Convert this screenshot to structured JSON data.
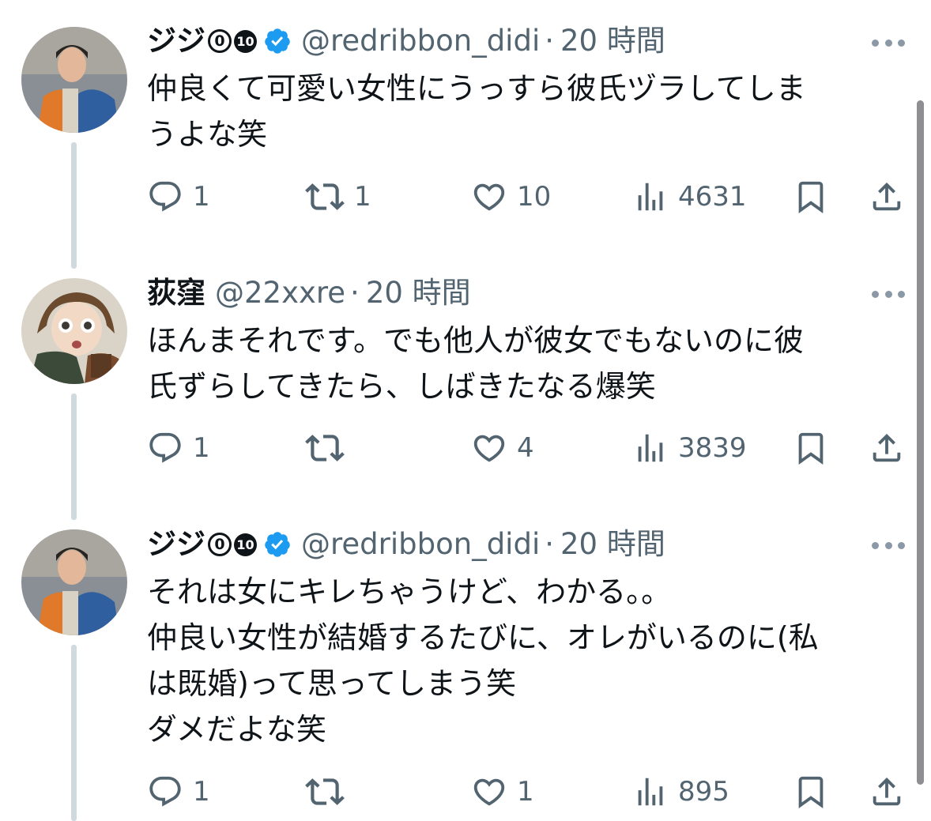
{
  "tweets": [
    {
      "name": "ジジ",
      "badge1": "0",
      "badge2": "10",
      "verified": true,
      "handle": "@redribbon_didi",
      "dot": "·",
      "time": "20 時間",
      "lines": [
        "仲良くて可愛い女性にうっすら彼氏ヅラしてしま",
        "うよな笑"
      ],
      "replies": "1",
      "retweets": "1",
      "likes": "10",
      "views": "4631"
    },
    {
      "name": "荻窪",
      "handle": "@22xxre",
      "dot": "·",
      "time": "20 時間",
      "lines": [
        "ほんまそれです。でも他人が彼女でもないのに彼",
        "氏ずらしてきたら、しばきたなる爆笑"
      ],
      "replies": "1",
      "retweets": "",
      "likes": "4",
      "views": "3839"
    },
    {
      "name": "ジジ",
      "badge1": "0",
      "badge2": "10",
      "verified": true,
      "handle": "@redribbon_didi",
      "dot": "·",
      "time": "20 時間",
      "lines": [
        "それは女にキレちゃうけど、わかる。。",
        "仲良い女性が結婚するたびに、オレがいるのに(私",
        "は既婚)って思ってしまう笑",
        "ダメだよな笑"
      ],
      "replies": "1",
      "retweets": "",
      "likes": "1",
      "views": "895"
    }
  ],
  "colors": {
    "text": "#0f1419",
    "secondary": "#536471",
    "verified": "#1d9bf0",
    "thread_line": "#cfd9de"
  },
  "icons": [
    "reply-icon",
    "retweet-icon",
    "like-icon",
    "views-icon",
    "bookmark-icon",
    "share-icon",
    "verified-icon",
    "more-icon"
  ]
}
